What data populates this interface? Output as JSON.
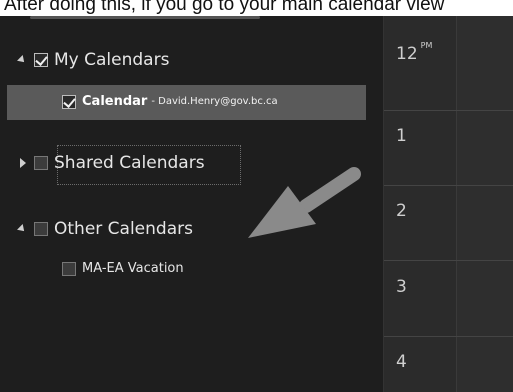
{
  "caption": {
    "text": "After doing this, if you go to your main calendar view"
  },
  "sidebar": {
    "my_calendars": {
      "label": "My Calendars",
      "checked": true,
      "expanded": true,
      "items": [
        {
          "name": "Calendar",
          "owner": "- David.Henry@gov.bc.ca",
          "checked": true,
          "selected": true
        }
      ]
    },
    "shared_calendars": {
      "label": "Shared Calendars",
      "checked": false,
      "expanded": false
    },
    "other_calendars": {
      "label": "Other Calendars",
      "checked": false,
      "expanded": true,
      "items": [
        {
          "name": "MA-EA Vacation",
          "checked": false
        }
      ]
    }
  },
  "time_grid": {
    "hours": [
      {
        "label": "12",
        "suffix": "PM"
      },
      {
        "label": "1",
        "suffix": ""
      },
      {
        "label": "2",
        "suffix": ""
      },
      {
        "label": "3",
        "suffix": ""
      },
      {
        "label": "4",
        "suffix": ""
      }
    ]
  },
  "colors": {
    "background": "#1e1e1e",
    "selected_row": "#5a5a5a",
    "time_column": "#2b2b2b",
    "arrow": "#8a8a8a"
  },
  "annotation": {
    "icon": "pointer-arrow-icon"
  }
}
